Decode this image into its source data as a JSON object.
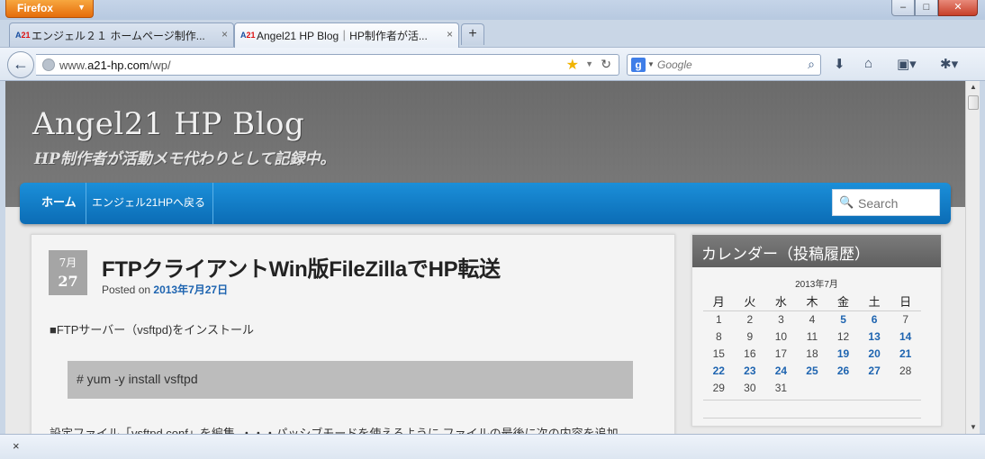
{
  "browser": {
    "app_button": "Firefox",
    "tabs": [
      {
        "label": "エンジェル２１ ホームページ制作..."
      },
      {
        "label": "Angel21 HP Blog｜HP制作者が活..."
      }
    ],
    "url_prefix": "www.",
    "url_domain": "a21-hp.com",
    "url_path": "/wp/",
    "search_placeholder": "Google"
  },
  "site": {
    "title": "Angel21 HP Blog",
    "description": "HP制作者が活動メモ代わりとして記録中。",
    "nav": {
      "home": "ホーム",
      "back": "エンジェル21HPへ戻る"
    },
    "search_placeholder": "Search"
  },
  "post": {
    "month": "7月",
    "day": "27",
    "title": "FTPクライアントWin版FileZillaでHP転送",
    "posted_prefix": "Posted on",
    "posted_date": "2013年7月27日",
    "para1": "■FTPサーバー（vsftpd)をインストール",
    "code": "# yum -y install vsftpd",
    "para2": "設定ファイル「vsftpd.conf」を編集．・・・パッシブモードを使えるように ファイルの最後に次の内容を追加."
  },
  "widget": {
    "title": "カレンダー（投稿履歴）",
    "caption": "2013年7月",
    "weekdays": [
      "月",
      "火",
      "水",
      "木",
      "金",
      "土",
      "日"
    ],
    "weeks": [
      [
        "1",
        "2",
        "3",
        "4",
        "5",
        "6",
        "7"
      ],
      [
        "8",
        "9",
        "10",
        "11",
        "12",
        "13",
        "14"
      ],
      [
        "15",
        "16",
        "17",
        "18",
        "19",
        "20",
        "21"
      ],
      [
        "22",
        "23",
        "24",
        "25",
        "26",
        "27",
        "28"
      ],
      [
        "29",
        "30",
        "31",
        "",
        "",
        "",
        ""
      ]
    ],
    "linked_days": [
      "5",
      "6",
      "13",
      "14",
      "19",
      "20",
      "21",
      "22",
      "23",
      "24",
      "25",
      "26",
      "27"
    ]
  },
  "statusbar": {
    "close": "×"
  }
}
